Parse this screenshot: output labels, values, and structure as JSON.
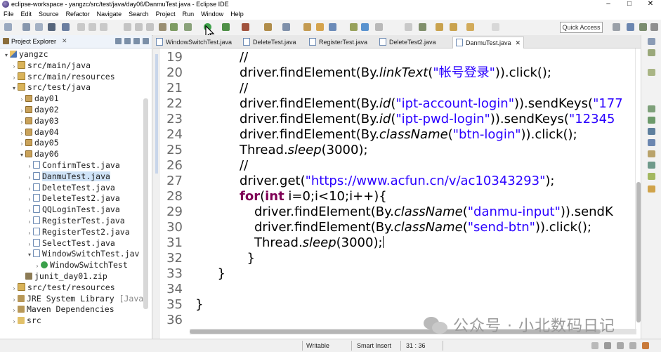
{
  "window": {
    "title": "eclipse-workspace - yangzc/src/test/java/day06/DanmuTest.java - Eclipse IDE",
    "controls": [
      "–",
      "□",
      "✕"
    ]
  },
  "menu": [
    "File",
    "Edit",
    "Source",
    "Refactor",
    "Navigate",
    "Search",
    "Project",
    "Run",
    "Window",
    "Help"
  ],
  "toolbar": {
    "quick_access": "Quick Access"
  },
  "explorer": {
    "title": "Project Explorer",
    "close": "✕",
    "tree": [
      {
        "label": "yangzc",
        "icon": "project-icon",
        "twisty": "▾",
        "depth": 0
      },
      {
        "label": "src/main/java",
        "icon": "source-folder-icon",
        "twisty": "›",
        "depth": 1
      },
      {
        "label": "src/main/resources",
        "icon": "source-folder-icon",
        "twisty": "›",
        "depth": 1
      },
      {
        "label": "src/test/java",
        "icon": "source-folder-icon",
        "twisty": "▾",
        "depth": 1
      },
      {
        "label": "day01",
        "icon": "package-icon",
        "twisty": "›",
        "depth": 2
      },
      {
        "label": "day02",
        "icon": "package-icon",
        "twisty": "›",
        "depth": 2
      },
      {
        "label": "day03",
        "icon": "package-icon",
        "twisty": "›",
        "depth": 2
      },
      {
        "label": "day04",
        "icon": "package-icon",
        "twisty": "›",
        "depth": 2
      },
      {
        "label": "day05",
        "icon": "package-icon",
        "twisty": "›",
        "depth": 2
      },
      {
        "label": "day06",
        "icon": "package-icon",
        "twisty": "▾",
        "depth": 2
      },
      {
        "label": "ConfirmTest.java",
        "icon": "java-file-icon",
        "twisty": "›",
        "depth": 3
      },
      {
        "label": "DanmuTest.java",
        "icon": "java-file-icon",
        "twisty": "›",
        "depth": 3,
        "selected": true
      },
      {
        "label": "DeleteTest.java",
        "icon": "java-file-icon",
        "twisty": "›",
        "depth": 3
      },
      {
        "label": "DeleteTest2.java",
        "icon": "java-file-icon",
        "twisty": "›",
        "depth": 3
      },
      {
        "label": "QQLoginTest.java",
        "icon": "java-file-icon",
        "twisty": "›",
        "depth": 3
      },
      {
        "label": "RegisterTest.java",
        "icon": "java-file-icon",
        "twisty": "›",
        "depth": 3
      },
      {
        "label": "RegisterTest2.java",
        "icon": "java-file-icon",
        "twisty": "›",
        "depth": 3
      },
      {
        "label": "SelectTest.java",
        "icon": "java-file-icon",
        "twisty": "›",
        "depth": 3
      },
      {
        "label": "WindowSwitchTest.jav",
        "icon": "java-file-icon",
        "twisty": "▾",
        "depth": 3
      },
      {
        "label": "WindowSwitchTest",
        "icon": "class-icon",
        "twisty": "›",
        "depth": 4
      },
      {
        "label": "junit_day01.zip",
        "icon": "zip-icon",
        "twisty": "",
        "depth": 2
      },
      {
        "label": "src/test/resources",
        "icon": "source-folder-icon",
        "twisty": "›",
        "depth": 1
      },
      {
        "label": "JRE System Library",
        "suffix": " [Java",
        "icon": "library-icon",
        "twisty": "›",
        "depth": 1
      },
      {
        "label": "Maven Dependencies",
        "icon": "library-icon",
        "twisty": "›",
        "depth": 1
      },
      {
        "label": "src",
        "icon": "folder-icon",
        "twisty": "›",
        "depth": 1
      }
    ]
  },
  "editor": {
    "tabs": [
      {
        "label": "WindowSwitchTest.java",
        "active": false
      },
      {
        "label": "DeleteTest.java",
        "active": false
      },
      {
        "label": "RegisterTest.java",
        "active": false
      },
      {
        "label": "DeleteTest2.java",
        "active": false
      },
      {
        "label": "DanmuTest.java",
        "active": true,
        "close": "✕"
      }
    ],
    "lines": [
      {
        "n": "19",
        "indent": 3,
        "parts": [
          [
            "c",
            "//"
          ]
        ]
      },
      {
        "n": "20",
        "indent": 3,
        "parts": [
          [
            "p",
            "driver.findElement(By."
          ],
          [
            "i",
            "linkText"
          ],
          [
            "p",
            "("
          ],
          [
            "s",
            "\"帐号登录\""
          ],
          [
            "p",
            "))."
          ],
          [
            "p",
            "click();"
          ]
        ]
      },
      {
        "n": "21",
        "indent": 3,
        "parts": [
          [
            "c",
            "//"
          ]
        ]
      },
      {
        "n": "22",
        "indent": 3,
        "parts": [
          [
            "p",
            "driver.findElement(By."
          ],
          [
            "i",
            "id"
          ],
          [
            "p",
            "("
          ],
          [
            "s",
            "\"ipt-account-login\""
          ],
          [
            "p",
            "))."
          ],
          [
            "p",
            "sendKeys("
          ],
          [
            "s",
            "\"177"
          ]
        ]
      },
      {
        "n": "23",
        "indent": 3,
        "parts": [
          [
            "p",
            "driver.findElement(By."
          ],
          [
            "i",
            "id"
          ],
          [
            "p",
            "("
          ],
          [
            "s",
            "\"ipt-pwd-login\""
          ],
          [
            "p",
            "))."
          ],
          [
            "p",
            "sendKeys("
          ],
          [
            "s",
            "\"12345"
          ]
        ]
      },
      {
        "n": "24",
        "indent": 3,
        "parts": [
          [
            "p",
            "driver.findElement(By."
          ],
          [
            "i",
            "className"
          ],
          [
            "p",
            "("
          ],
          [
            "s",
            "\"btn-login\""
          ],
          [
            "p",
            "))."
          ],
          [
            "p",
            "click();"
          ]
        ]
      },
      {
        "n": "25",
        "indent": 3,
        "parts": [
          [
            "p",
            "Thread."
          ],
          [
            "i",
            "sleep"
          ],
          [
            "p",
            "(3000);"
          ]
        ]
      },
      {
        "n": "26",
        "indent": 3,
        "parts": [
          [
            "c",
            "//"
          ]
        ]
      },
      {
        "n": "27",
        "indent": 3,
        "parts": [
          [
            "p",
            "driver.get("
          ],
          [
            "s",
            "\"https://www.acfun.cn/v/ac10343293\""
          ],
          [
            "p",
            ");"
          ]
        ]
      },
      {
        "n": "28",
        "indent": 3,
        "parts": [
          [
            "k",
            "for"
          ],
          [
            "p",
            "("
          ],
          [
            "k",
            "int"
          ],
          [
            "p",
            " i=0;i<10;i++){"
          ]
        ]
      },
      {
        "n": "29",
        "indent": 4,
        "parts": [
          [
            "p",
            "driver.findElement(By."
          ],
          [
            "i",
            "className"
          ],
          [
            "p",
            "("
          ],
          [
            "s",
            "\"danmu-input\""
          ],
          [
            "p",
            "))."
          ],
          [
            "p",
            "sendK"
          ]
        ]
      },
      {
        "n": "30",
        "indent": 4,
        "parts": [
          [
            "p",
            "driver.findElement(By."
          ],
          [
            "i",
            "className"
          ],
          [
            "p",
            "("
          ],
          [
            "s",
            "\"send-btn\""
          ],
          [
            "p",
            "))."
          ],
          [
            "p",
            "click();"
          ]
        ]
      },
      {
        "n": "31",
        "indent": 4,
        "parts": [
          [
            "p",
            "Thread."
          ],
          [
            "i",
            "sleep"
          ],
          [
            "p",
            "(3000);"
          ]
        ],
        "cursor": true
      },
      {
        "n": "32",
        "indent": 3.5,
        "parts": [
          [
            "p",
            "}"
          ]
        ]
      },
      {
        "n": "33",
        "indent": 1.5,
        "parts": [
          [
            "p",
            "}"
          ]
        ]
      },
      {
        "n": "34",
        "indent": 0,
        "parts": []
      },
      {
        "n": "35",
        "indent": 0,
        "parts": [
          [
            "p",
            "}"
          ]
        ]
      },
      {
        "n": "36",
        "indent": 0,
        "parts": []
      }
    ]
  },
  "status": {
    "writable": "Writable",
    "insert_mode": "Smart Insert",
    "position": "31 : 36"
  },
  "watermark": {
    "text": "公众号 · 小北数码日记"
  },
  "colors": {
    "keyword": "#7f0055",
    "string": "#2a00ff",
    "line_number": "#6a6a6a",
    "selection": "#cfe3f7"
  }
}
